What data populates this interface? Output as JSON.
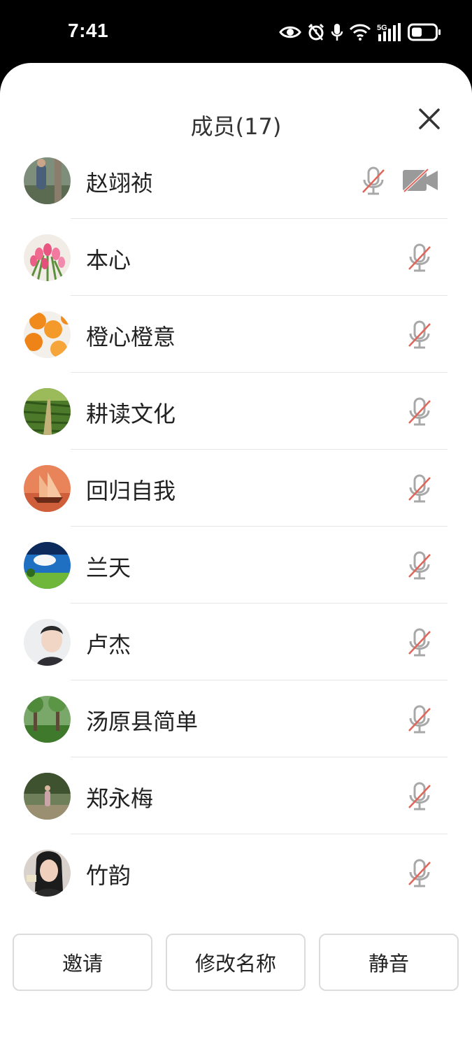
{
  "status_bar": {
    "time": "7:41",
    "network": "5G",
    "icons": [
      "eye-icon",
      "alarm-icon",
      "microphone-icon",
      "wifi-icon",
      "cellular-signal-icon",
      "battery-icon"
    ]
  },
  "panel": {
    "title": "成员(17)",
    "close_icon": "close-icon"
  },
  "members": [
    {
      "name": "赵翊祯",
      "mic_muted": true,
      "camera_off": true,
      "avatar": "outdoor-person-photo"
    },
    {
      "name": "本心",
      "mic_muted": true,
      "avatar": "pink-tulips-photo"
    },
    {
      "name": "橙心橙意",
      "mic_muted": true,
      "avatar": "oranges-photo"
    },
    {
      "name": "耕读文化",
      "mic_muted": true,
      "avatar": "green-field-path-photo"
    },
    {
      "name": "回归自我",
      "mic_muted": true,
      "avatar": "sailing-ship-sunset-photo"
    },
    {
      "name": "兰天",
      "mic_muted": true,
      "avatar": "blue-sky-meadow-photo"
    },
    {
      "name": "卢杰",
      "mic_muted": true,
      "avatar": "portrait-photo"
    },
    {
      "name": "汤原县简单",
      "mic_muted": true,
      "avatar": "park-trees-photo"
    },
    {
      "name": "郑永梅",
      "mic_muted": true,
      "avatar": "woman-in-garden-photo"
    },
    {
      "name": "竹韵",
      "mic_muted": true,
      "avatar": "woman-portrait-photo"
    }
  ],
  "actions": {
    "invite": "邀请",
    "rename": "修改名称",
    "mute": "静音"
  },
  "colors": {
    "mute_slash": "#e0655a",
    "icon_gray": "#a0a0a0",
    "text": "#222222"
  }
}
